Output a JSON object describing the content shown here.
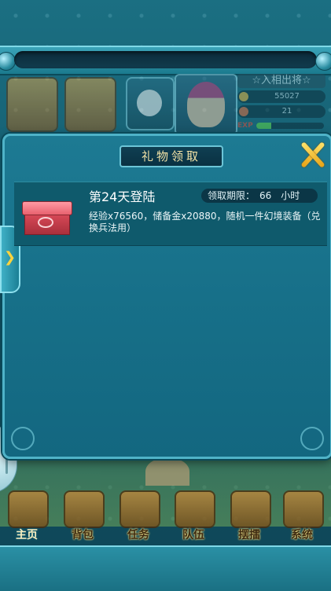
{
  "hud": {
    "title": "☆入相出将☆",
    "stat1": "55027",
    "stat2": "21",
    "exp_label": "EXP",
    "exp_progress": 0.22
  },
  "modal": {
    "title": "礼物领取",
    "close_icon": "close-x-icon",
    "side_tab_icon": "chevron-right-icon",
    "reward": {
      "title": "第24天登陆",
      "limit_label": "领取期限：",
      "limit_value": "66",
      "limit_unit": "小时",
      "description": "经验x76560，储备金x20880，随机一件幻境装备（兑换兵法用）",
      "icon": "red-chest-icon"
    }
  },
  "nav": {
    "items": [
      {
        "label": "主页",
        "icon": "home-icon"
      },
      {
        "label": "背包",
        "icon": "bag-icon"
      },
      {
        "label": "任务",
        "icon": "task-scroll-icon"
      },
      {
        "label": "队伍",
        "icon": "team-icon"
      },
      {
        "label": "摆擂",
        "icon": "arena-icon"
      },
      {
        "label": "系统",
        "icon": "settings-gear-icon"
      }
    ]
  },
  "colors": {
    "panel": "#177089",
    "title_text": "#f2e2a6",
    "close_accent": "#ffd33c"
  }
}
